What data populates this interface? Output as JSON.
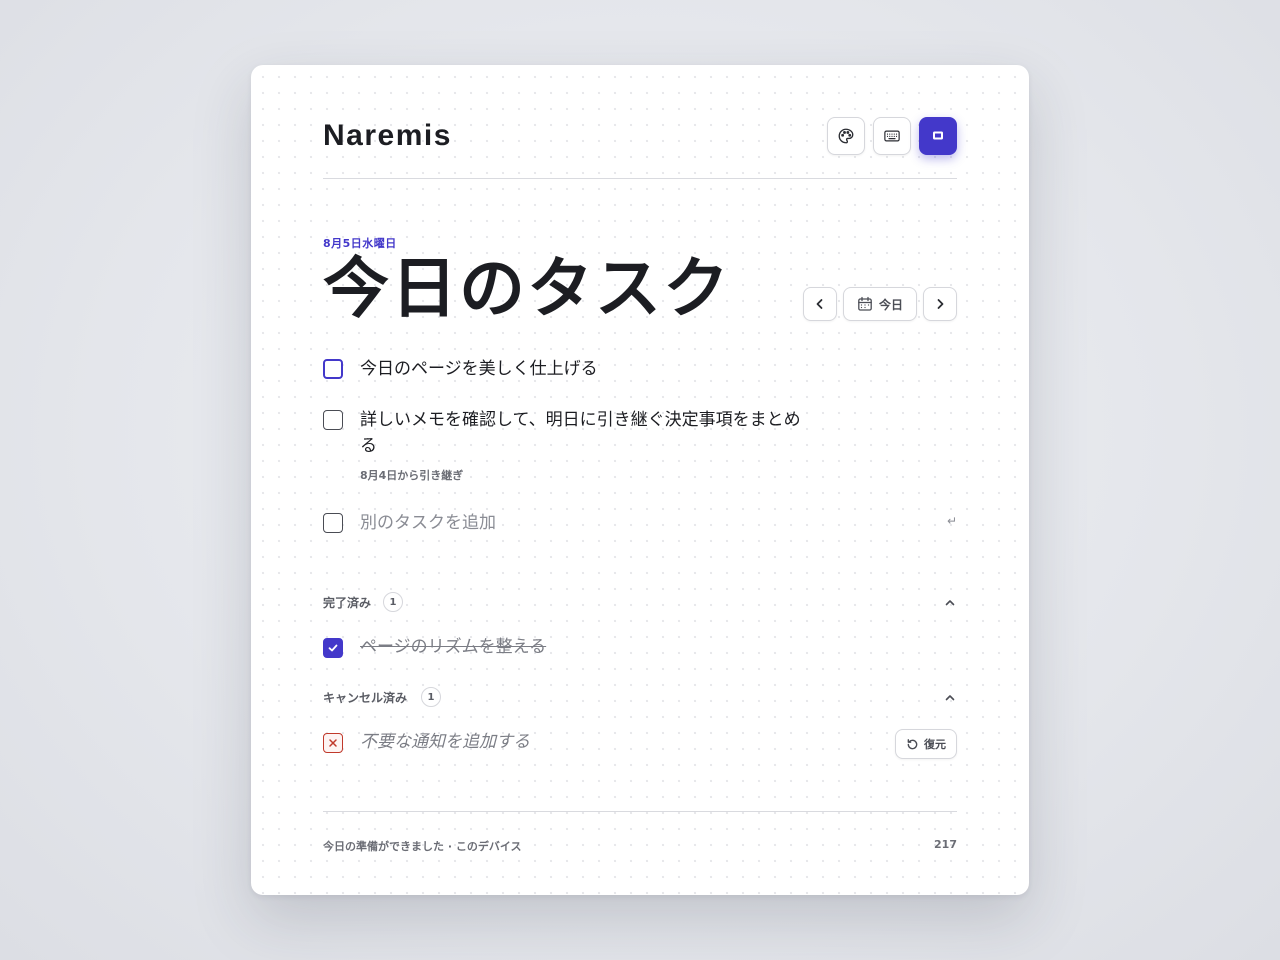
{
  "app": {
    "name": "Naremis"
  },
  "header": {
    "buttons": [
      {
        "icon": "palette-icon",
        "active": false
      },
      {
        "icon": "keyboard-icon",
        "active": false
      },
      {
        "icon": "focus-mode-icon",
        "active": true
      }
    ]
  },
  "page": {
    "date": "8月5日水曜日",
    "title": "今日のタスク"
  },
  "date_nav": {
    "today_label": "今日",
    "prev_icon": "chevron-left-icon",
    "next_icon": "chevron-right-icon",
    "calendar_icon": "calendar-icon"
  },
  "tasks": [
    {
      "text": "今日のページを美しく仕上げる",
      "checked": false,
      "focused": true
    },
    {
      "text": "詳しいメモを確認して、明日に引き継ぐ決定事項をまとめる",
      "note": "8月4日から引き継ぎ",
      "checked": false
    }
  ],
  "new_task": {
    "placeholder": "別のタスクを追加",
    "enter_hint": "↵"
  },
  "completed": {
    "title": "完了済み",
    "count": "1",
    "items": [
      {
        "text": "ページのリズムを整える"
      }
    ]
  },
  "cancelled": {
    "title": "キャンセル済み",
    "count": "1",
    "items": [
      {
        "text": "不要な通知を追加する",
        "restore_label": "復元"
      }
    ]
  },
  "footer": {
    "status": "今日の準備ができました · このデバイス",
    "count": "217"
  },
  "colors": {
    "accent": "#4338ca",
    "cancel": "#c0392b",
    "text": "#1c1d22"
  }
}
